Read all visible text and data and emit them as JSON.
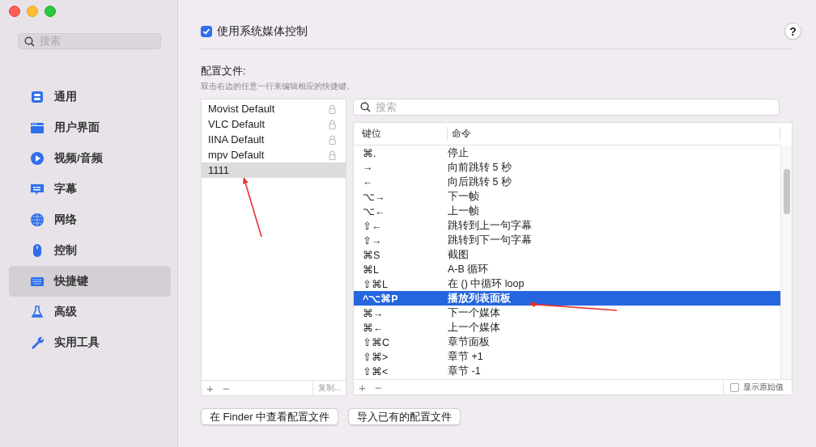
{
  "sidebar": {
    "search": {
      "placeholder": "搜索"
    },
    "items": [
      {
        "label": "通用",
        "selected": false
      },
      {
        "label": "用户界面",
        "selected": false
      },
      {
        "label": "视频/音频",
        "selected": false
      },
      {
        "label": "字幕",
        "selected": false
      },
      {
        "label": "网络",
        "selected": false
      },
      {
        "label": "控制",
        "selected": false
      },
      {
        "label": "快捷键",
        "selected": true
      },
      {
        "label": "高级",
        "selected": false
      },
      {
        "label": "实用工具",
        "selected": false
      }
    ]
  },
  "media_control": {
    "label": "使用系统媒体控制",
    "checked": true
  },
  "help_button": "?",
  "profiles": {
    "title": "配置文件:",
    "hint": "双击右边的任意一行来编辑相应的快捷键。",
    "items": [
      {
        "name": "Movist Default",
        "locked": true,
        "selected": false
      },
      {
        "name": "VLC Default",
        "locked": true,
        "selected": false
      },
      {
        "name": "IINA Default",
        "locked": true,
        "selected": false
      },
      {
        "name": "mpv Default",
        "locked": true,
        "selected": false
      },
      {
        "name": "1111",
        "locked": false,
        "selected": true
      }
    ],
    "add": "+",
    "remove": "−",
    "copy_button": "复制..."
  },
  "shortcuts": {
    "search": {
      "placeholder": "搜索"
    },
    "columns": [
      "键位",
      "命令"
    ],
    "rows": [
      {
        "key": "⌘.",
        "command": "停止",
        "selected": false
      },
      {
        "key": "→",
        "command": "向前跳转 5 秒",
        "selected": false
      },
      {
        "key": "←",
        "command": "向后跳转 5 秒",
        "selected": false
      },
      {
        "key": "⌥→",
        "command": "下一帧",
        "selected": false
      },
      {
        "key": "⌥←",
        "command": "上一帧",
        "selected": false
      },
      {
        "key": "⇧←",
        "command": "跳转到上一句字幕",
        "selected": false
      },
      {
        "key": "⇧→",
        "command": "跳转到下一句字幕",
        "selected": false
      },
      {
        "key": "⌘S",
        "command": "截图",
        "selected": false
      },
      {
        "key": "⌘L",
        "command": "A-B 循环",
        "selected": false
      },
      {
        "key": "⇧⌘L",
        "command": "在 () 中循环 loop",
        "selected": false
      },
      {
        "key": "^⌥⌘P",
        "command": "播放列表面板",
        "selected": true
      },
      {
        "key": "⌘→",
        "command": "下一个媒体",
        "selected": false
      },
      {
        "key": "⌘←",
        "command": "上一个媒体",
        "selected": false
      },
      {
        "key": "⇧⌘C",
        "command": "章节面板",
        "selected": false
      },
      {
        "key": "⇧⌘>",
        "command": "章节 +1",
        "selected": false
      },
      {
        "key": "⇧⌘<",
        "command": "章节 -1",
        "selected": false
      }
    ],
    "add": "+",
    "remove": "−",
    "show_raw": {
      "label": "显示原始值",
      "checked": false
    }
  },
  "buttons": [
    "在 Finder 中查看配置文件",
    "导入已有的配置文件"
  ],
  "annotations": [
    {
      "kind": "arrow"
    },
    {
      "kind": "arrow"
    }
  ]
}
